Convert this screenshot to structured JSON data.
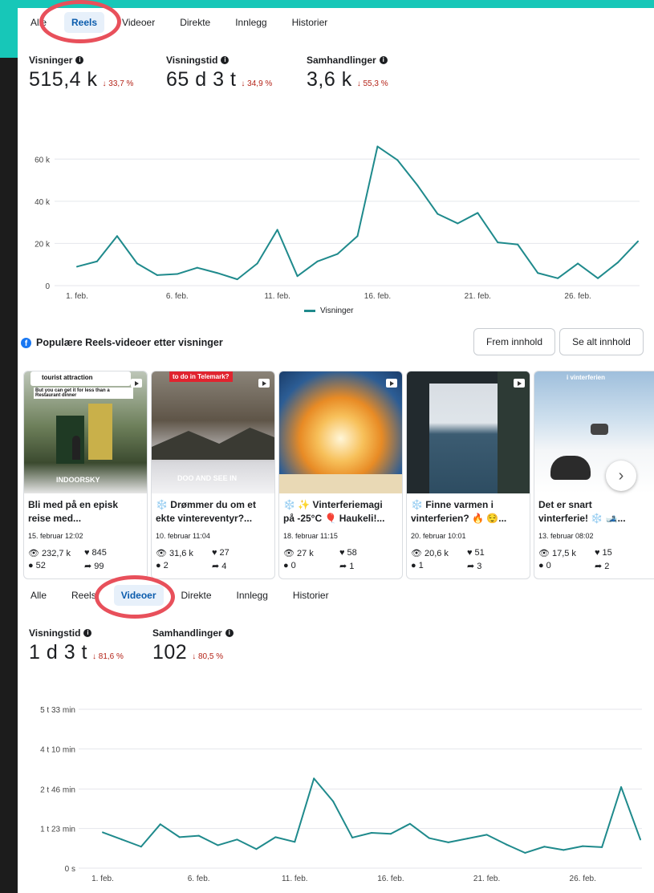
{
  "tabs_top": [
    "Alle",
    "Reels",
    "Videoer",
    "Direkte",
    "Innlegg",
    "Historier"
  ],
  "tabs_bottom": [
    "Alle",
    "Reels",
    "Videoer",
    "Direkte",
    "Innlegg",
    "Historier"
  ],
  "reels_metrics": [
    {
      "label": "Visninger",
      "value": "515,4 k",
      "change": "↓ 33,7 %"
    },
    {
      "label": "Visningstid",
      "value": "65 d 3 t",
      "change": "↓ 34,9 %"
    },
    {
      "label": "Samhandlinger",
      "value": "3,6 k",
      "change": "↓ 55,3 %"
    }
  ],
  "video_metrics": [
    {
      "label": "Visningstid",
      "value": "1 d 3 t",
      "change": "↓ 81,6 %"
    },
    {
      "label": "Samhandlinger",
      "value": "102",
      "change": "↓ 80,5 %"
    }
  ],
  "chart_data": [
    {
      "type": "line",
      "ytick_labels": [
        "0",
        "20 k",
        "40 k",
        "60 k"
      ],
      "ytick_values": [
        0,
        20000,
        40000,
        60000
      ],
      "xtick_labels": [
        "1. feb.",
        "6. feb.",
        "11. feb.",
        "16. feb.",
        "21. feb.",
        "26. feb."
      ],
      "x": [
        1,
        2,
        3,
        4,
        5,
        6,
        7,
        8,
        9,
        10,
        11,
        12,
        13,
        14,
        15,
        16,
        17,
        18,
        19,
        20,
        21,
        22,
        23,
        24,
        25,
        26,
        27,
        28,
        29
      ],
      "series": [
        {
          "name": "Visninger",
          "values": [
            9000,
            11500,
            23500,
            10500,
            5000,
            5500,
            8500,
            6000,
            3000,
            10500,
            26500,
            4500,
            11500,
            15000,
            23500,
            66000,
            59500,
            47500,
            34000,
            29500,
            34500,
            20500,
            19500,
            6000,
            3500,
            10500,
            3500,
            11000,
            21000
          ]
        }
      ],
      "ylim": [
        0,
        70000
      ],
      "legend": "bottom",
      "color": "#1f8a8c"
    },
    {
      "type": "line",
      "ytick_labels": [
        "0 s",
        "1 t 23 min",
        "2 t 46 min",
        "4 t 10 min",
        "5 t 33 min"
      ],
      "ytick_values": [
        0,
        83,
        166,
        250,
        333
      ],
      "xtick_labels": [
        "1. feb.",
        "6. feb.",
        "11. feb.",
        "16. feb.",
        "21. feb.",
        "26. feb."
      ],
      "x": [
        1,
        2,
        3,
        4,
        5,
        6,
        7,
        8,
        9,
        10,
        11,
        12,
        13,
        14,
        15,
        16,
        17,
        18,
        19,
        20,
        21,
        22,
        23,
        24,
        25,
        26,
        27,
        28,
        29
      ],
      "series": [
        {
          "values": [
            75,
            60,
            45,
            92,
            65,
            68,
            48,
            60,
            40,
            65,
            55,
            188,
            140,
            64,
            74,
            72,
            93,
            63,
            54,
            62,
            70,
            50,
            32,
            45,
            38,
            46,
            44,
            170,
            60
          ]
        }
      ],
      "ylim": [
        0,
        360
      ],
      "color": "#1f8a8c"
    }
  ],
  "popular": {
    "title": "Populære Reels-videoer etter visninger",
    "buttons": [
      "Frem innhold",
      "Se alt innhold"
    ],
    "cards": [
      {
        "title": "Bli med på en episk\nreise med...",
        "date": "15. februar 12:02",
        "views": "232,7 k",
        "likes": "845",
        "comments": "52",
        "shares": "99",
        "overlay_top": "tourist attraction",
        "overlay_sub": "But you can get it for less than a Restaurant dinner",
        "overlay_bottom": "INDOORSKY",
        "bg": "#4a5d3e"
      },
      {
        "title": "❄️ Drømmer du om et\nekte vintereventyr?...",
        "date": "10. februar 11:04",
        "views": "31,6 k",
        "likes": "27",
        "comments": "2",
        "shares": "4",
        "overlay_top": "to do in Telemark?",
        "overlay_bottom": "DOO AND SEE IN",
        "bg": "#6f6559"
      },
      {
        "title": "❄️ ✨ Vinterferiemagi\npå -25°C 🎈 Haukeli!...",
        "date": "18. februar 11:15",
        "views": "27 k",
        "likes": "58",
        "comments": "0",
        "shares": "1",
        "bg": "#f0a646"
      },
      {
        "title": "❄️ Finne varmen i\nvinterferien? 🔥 😌...",
        "date": "20. februar 10:01",
        "views": "20,6 k",
        "likes": "51",
        "comments": "1",
        "shares": "3",
        "bg": "#2e4b5d"
      },
      {
        "title": "Det er snart\nvinterferie! ❄️ 🎿...",
        "date": "13. februar 08:02",
        "views": "17,5 k",
        "likes": "15",
        "comments": "0",
        "shares": "2",
        "overlay_top": "i vinterferien",
        "bg": "#b9cfe0"
      }
    ]
  }
}
